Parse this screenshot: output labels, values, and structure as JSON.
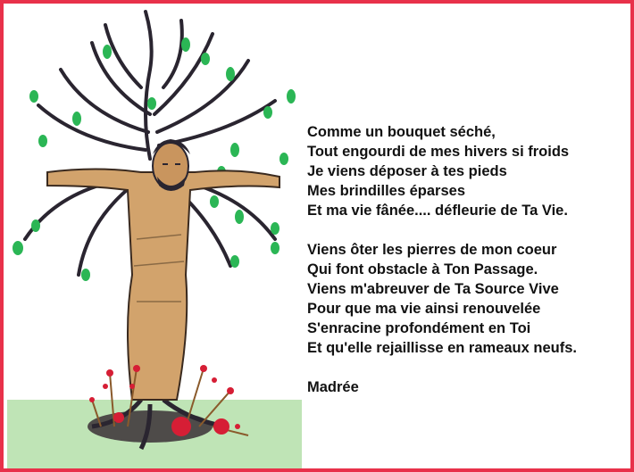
{
  "colors": {
    "border": "#e8314a",
    "background": "#ffffff",
    "text": "#111111",
    "leaf": "#2bb655",
    "branch": "#2a2530",
    "figure": "#d2a36c",
    "ground": "#b8e0b0",
    "flower": "#d61e35"
  },
  "illustration": {
    "icon": "tree-crucifix-drawing-icon"
  },
  "poem": {
    "stanzas": [
      {
        "lines": [
          "Comme un bouquet séché,",
          "Tout engourdi de mes hivers si froids",
          "Je viens déposer à tes pieds",
          "Mes brindilles éparses",
          "Et ma vie fânée.... défleurie de Ta Vie."
        ]
      },
      {
        "lines": [
          "Viens ôter les pierres de mon coeur",
          "Qui font obstacle à Ton Passage.",
          "Viens m'abreuver de Ta Source Vive",
          "Pour que ma vie ainsi renouvelée",
          "S'enracine profondément en Toi",
          "Et qu'elle rejaillisse en rameaux neufs."
        ]
      }
    ],
    "author": "Madrée"
  }
}
